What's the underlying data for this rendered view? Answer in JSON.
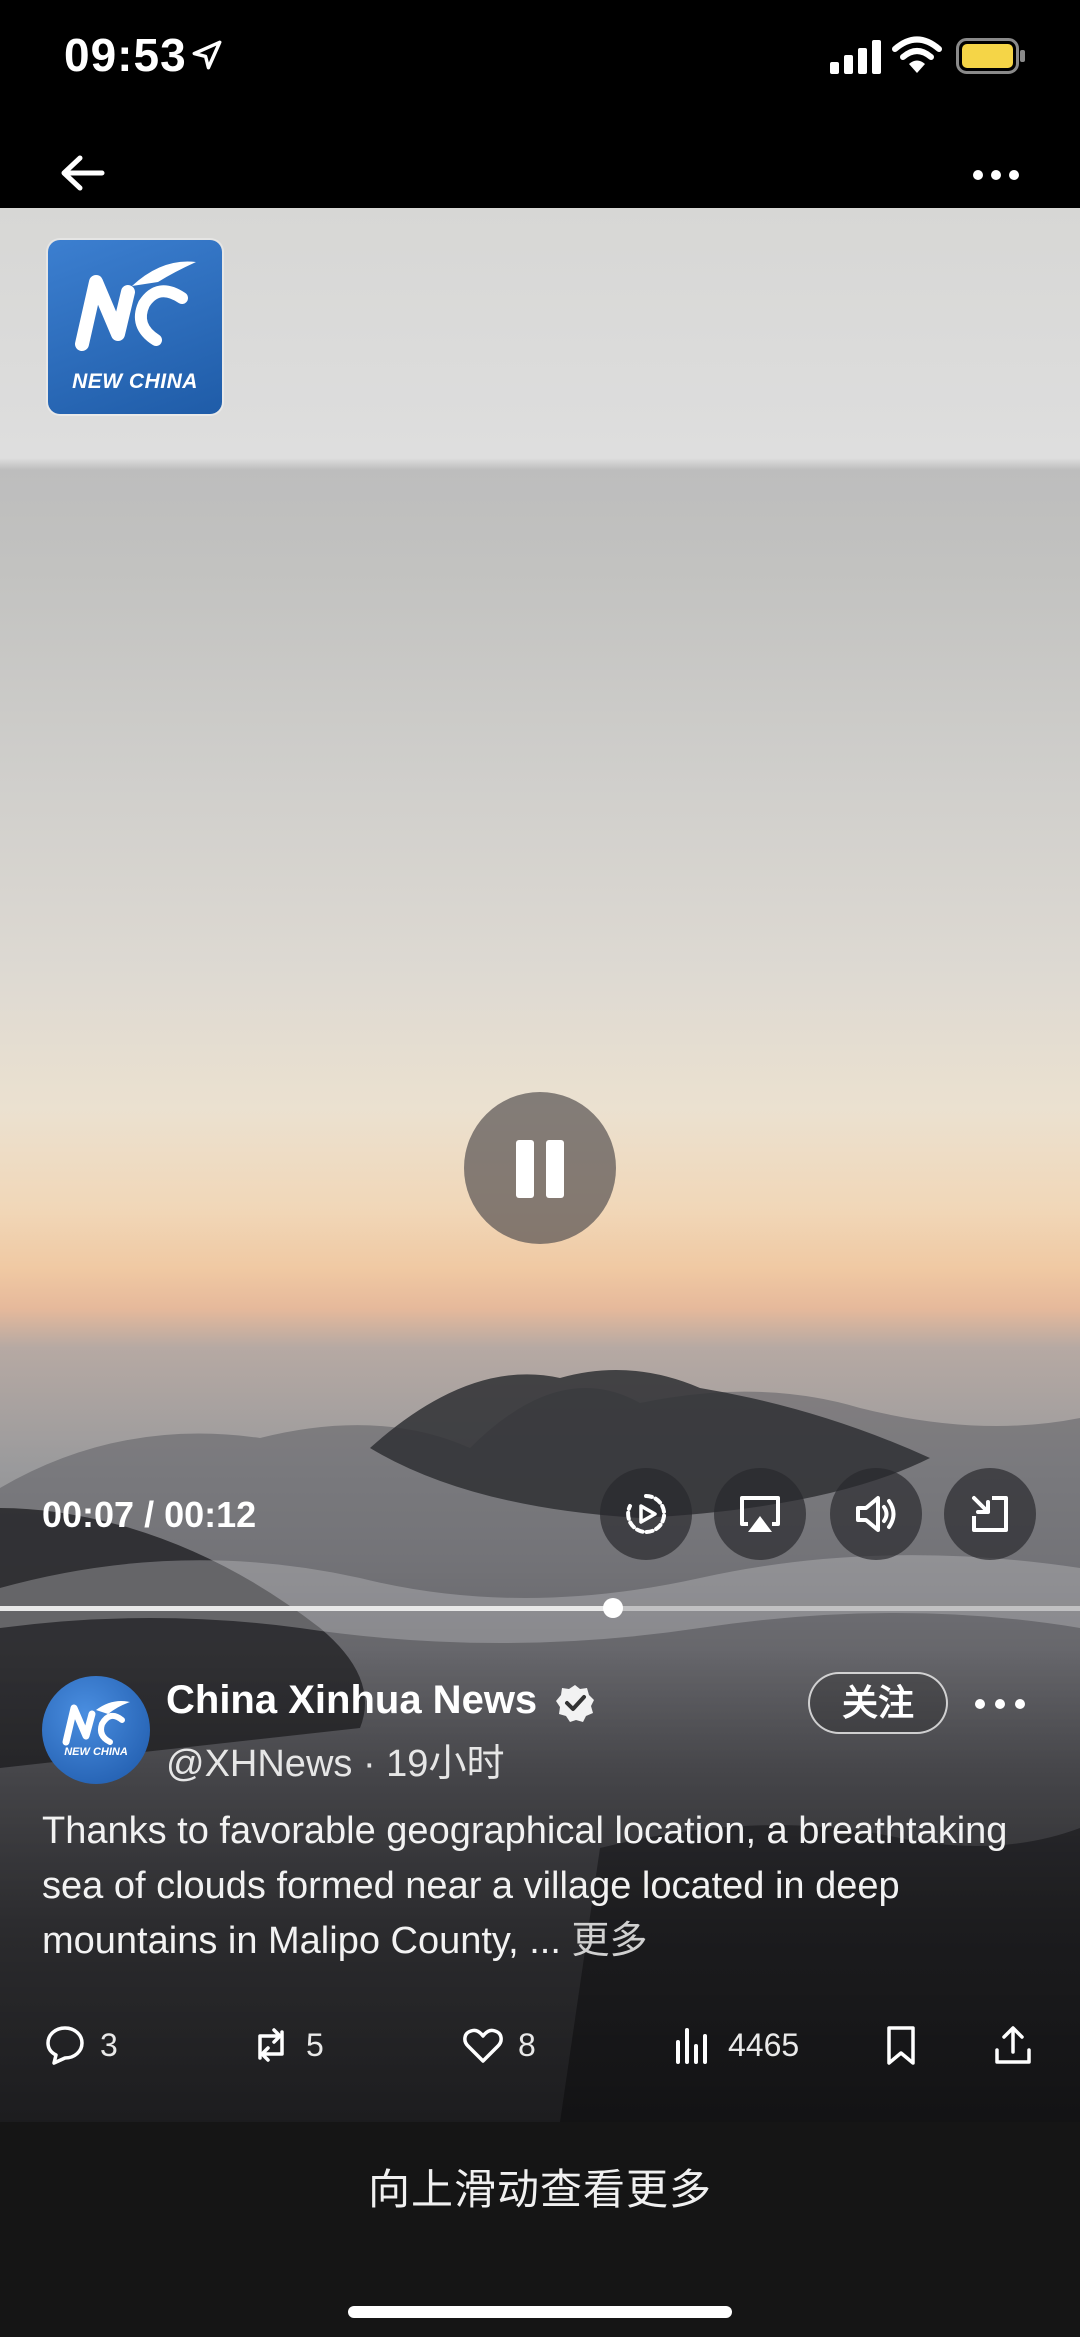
{
  "status_bar": {
    "time": "09:53"
  },
  "video": {
    "logo_text": "NEW CHINA",
    "time_current": "00:07",
    "time_total": "00:12",
    "time_readout": "00:07 / 00:12",
    "progress": 0.568,
    "state": "playing"
  },
  "post": {
    "avatar_text": "NEW CHINA",
    "display_name": "China Xinhua News",
    "handle": "@XHNews",
    "separator": "·",
    "time_ago": "19小时",
    "follow_label": "关注",
    "text": "Thanks to favorable geographical location, a breathtaking sea of clouds formed near a village located in deep mountains in Malipo County, ... ",
    "more_label": "更多",
    "actions": {
      "replies": "3",
      "reposts": "5",
      "likes": "8",
      "views": "4465"
    }
  },
  "bottom": {
    "swipe_hint": "向上滑动查看更多"
  },
  "colors": {
    "background": "#000000",
    "bottom_bar": "#151515",
    "battery": "#f5d547",
    "avatar_blue": "#1f5ca8"
  }
}
